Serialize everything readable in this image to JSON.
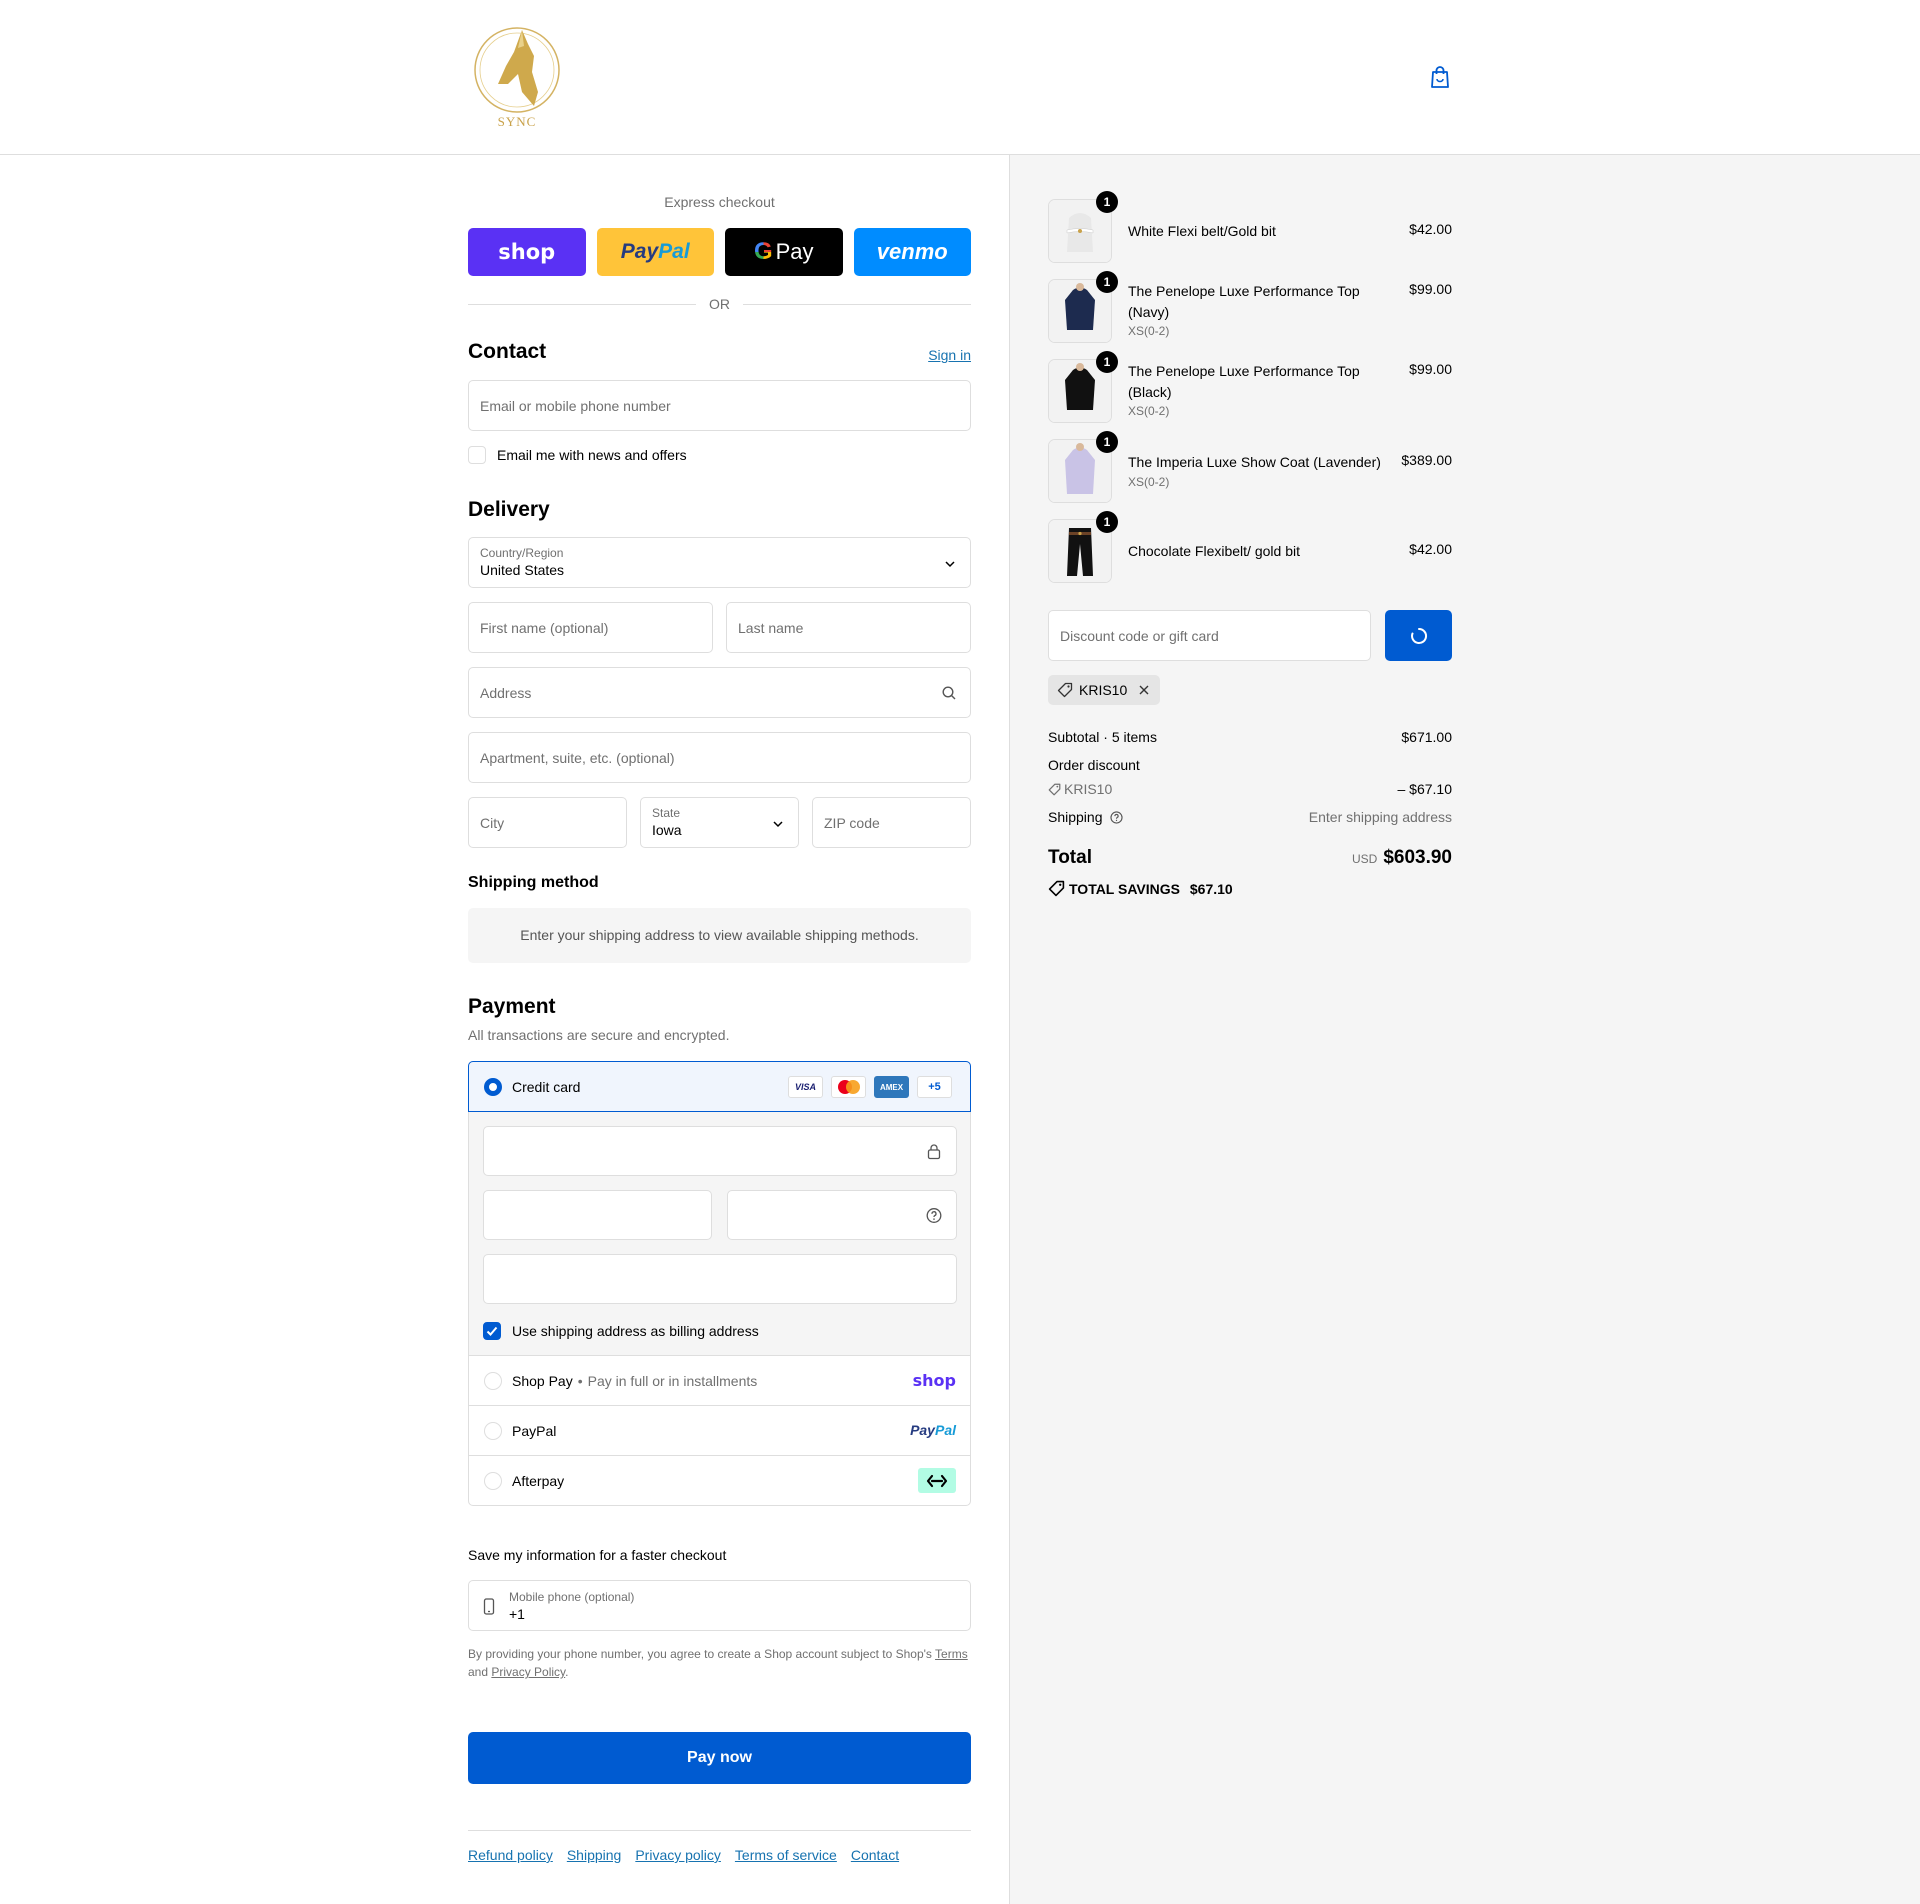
{
  "header": {
    "logo_text": "SYNC",
    "cart_label": "Cart"
  },
  "express": {
    "title": "Express checkout",
    "shop_label": "shop",
    "paypal_a": "Pay",
    "paypal_b": "Pal",
    "gpay_g": "G",
    "gpay_label": "Pay",
    "venmo_label": "venmo",
    "or_label": "OR"
  },
  "contact": {
    "title": "Contact",
    "sign_in": "Sign in",
    "email_placeholder": "Email or mobile phone number",
    "news_label": "Email me with news and offers"
  },
  "delivery": {
    "title": "Delivery",
    "country_label": "Country/Region",
    "country_value": "United States",
    "first_name_placeholder": "First name (optional)",
    "last_name_placeholder": "Last name",
    "address_placeholder": "Address",
    "apartment_placeholder": "Apartment, suite, etc. (optional)",
    "city_placeholder": "City",
    "state_label": "State",
    "state_value": "Iowa",
    "zip_placeholder": "ZIP code"
  },
  "shipping": {
    "title": "Shipping method",
    "info": "Enter your shipping address to view available shipping methods."
  },
  "payment": {
    "title": "Payment",
    "subtitle": "All transactions are secure and encrypted.",
    "credit_card_label": "Credit card",
    "brands": [
      "VISA",
      "",
      "AMEX",
      "+5"
    ],
    "billing_label": "Use shipping address as billing address",
    "shop_pay_label": "Shop Pay",
    "shop_pay_sub": "Pay in full or in installments",
    "shop_pay_logo": "shop",
    "paypal_label": "PayPal",
    "paypal_logo_a": "Pay",
    "paypal_logo_b": "Pal",
    "afterpay_label": "Afterpay"
  },
  "save": {
    "title": "Save my information for a faster checkout",
    "phone_label": "Mobile phone (optional)",
    "phone_value": "+1",
    "legal_1": "By providing your phone number, you agree to create a Shop account subject to Shop's ",
    "terms": "Terms",
    "legal_2": "and ",
    "privacy": "Privacy Policy",
    "legal_3": "."
  },
  "pay_now": "Pay now",
  "footer": {
    "links": [
      "Refund policy",
      "Shipping",
      "Privacy policy",
      "Terms of service",
      "Contact"
    ]
  },
  "summary": {
    "items": [
      {
        "qty": "1",
        "name": "White Flexi belt/Gold bit",
        "variant": "",
        "price": "$42.00"
      },
      {
        "qty": "1",
        "name": "The Penelope Luxe Performance Top (Navy)",
        "variant": "XS(0-2)",
        "price": "$99.00"
      },
      {
        "qty": "1",
        "name": "The Penelope Luxe Performance Top (Black)",
        "variant": "XS(0-2)",
        "price": "$99.00"
      },
      {
        "qty": "1",
        "name": "The Imperia Luxe Show Coat (Lavender)",
        "variant": "XS(0-2)",
        "price": "$389.00"
      },
      {
        "qty": "1",
        "name": "Chocolate Flexibelt/ gold bit",
        "variant": "",
        "price": "$42.00"
      }
    ],
    "discount_placeholder": "Discount code or gift card",
    "applied_code": "KRIS10",
    "subtotal_label": "Subtotal · 5 items",
    "subtotal_value": "$671.00",
    "order_discount_label": "Order discount",
    "discount_code": "KRIS10",
    "discount_value": "– $67.10",
    "shipping_label": "Shipping",
    "shipping_value": "Enter shipping address",
    "total_label": "Total",
    "currency": "USD",
    "total_value": "$603.90",
    "savings_label": "TOTAL SAVINGS",
    "savings_value": "$67.10"
  },
  "colors": {
    "accent": "#005bd1",
    "link": "#1773b0",
    "shop_purple": "#5a31f4",
    "paypal_yellow": "#ffc439",
    "venmo_blue": "#008cff",
    "afterpay_mint": "#b2fce4"
  }
}
